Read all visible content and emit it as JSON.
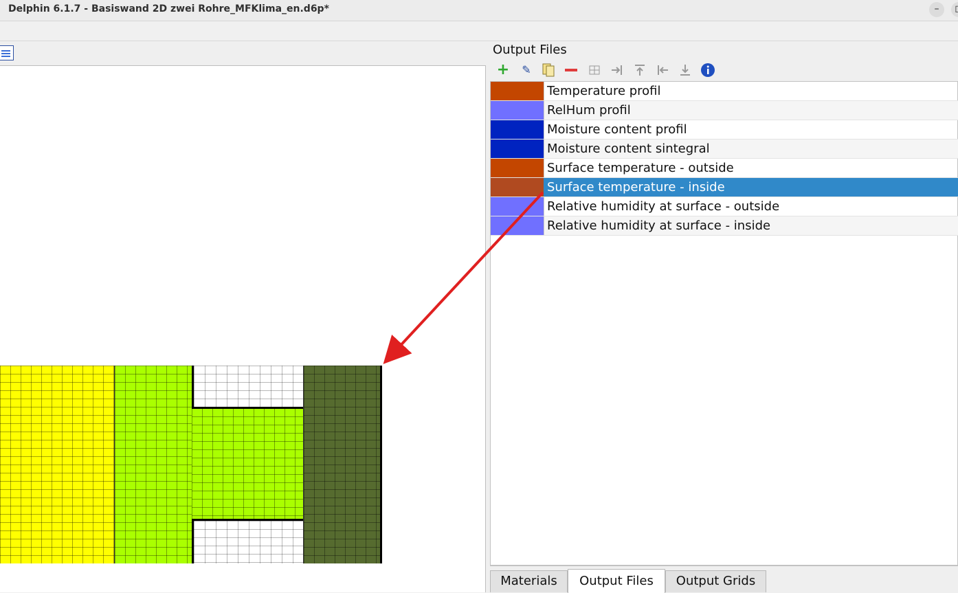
{
  "window": {
    "title": "Delphin 6.1.7 - Basiswand 2D zwei Rohre_MFKlima_en.d6p*"
  },
  "panel": {
    "title": "Output Files",
    "toolbar_icons": [
      "add-icon",
      "edit-icon",
      "copy-icon",
      "remove-icon",
      "grid-icon",
      "move-right-icon",
      "move-up-icon",
      "move-left-icon",
      "move-down-icon",
      "info-icon"
    ]
  },
  "outputs": [
    {
      "label": "Temperature profil",
      "color": "#c34600"
    },
    {
      "label": "RelHum profil",
      "color": "#7070ff"
    },
    {
      "label": "Moisture content profil",
      "color": "#0023c0"
    },
    {
      "label": "Moisture content sintegral",
      "color": "#0023c0"
    },
    {
      "label": "Surface temperature - outside",
      "color": "#c34600"
    },
    {
      "label": "Surface temperature - inside",
      "color": "#b04a20",
      "selected": true
    },
    {
      "label": "Relative humidity at surface - outside",
      "color": "#7070ff"
    },
    {
      "label": "Relative humidity at surface - inside",
      "color": "#7070ff"
    }
  ],
  "tabs": [
    {
      "label": "Materials"
    },
    {
      "label": "Output Files",
      "active": true
    },
    {
      "label": "Output Grids"
    }
  ],
  "materials": {
    "yellow": "#ffff00",
    "lime": "#aaff00",
    "olive": "#566b2f",
    "white": "#ffffff"
  },
  "annotation": {
    "arrow_color": "#e02020"
  }
}
